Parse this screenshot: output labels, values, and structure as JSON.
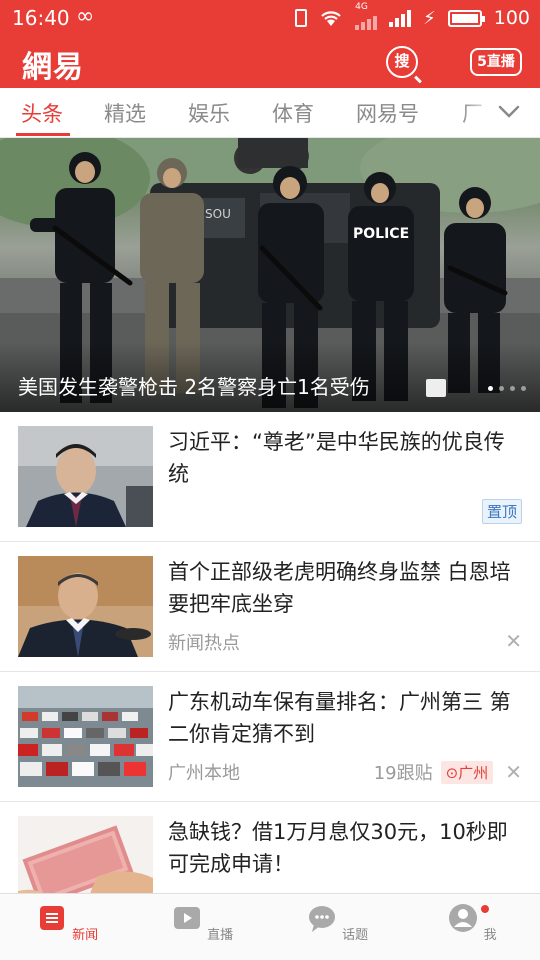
{
  "status_bar": {
    "time": "16:40",
    "infinity": "∞",
    "network": "4G",
    "battery": "100"
  },
  "app_bar": {
    "logo": "網易",
    "search_label": "搜",
    "live_label": "5直播"
  },
  "tabs": [
    {
      "label": "头条",
      "active": true
    },
    {
      "label": "精选",
      "active": false
    },
    {
      "label": "娱乐",
      "active": false
    },
    {
      "label": "体育",
      "active": false
    },
    {
      "label": "网易号",
      "active": false
    },
    {
      "label": "厂",
      "active": false
    }
  ],
  "hero": {
    "caption": "美国发生袭警枪击 2名警察身亡1名受伤",
    "vehicle_text": "SOU",
    "vest_text": "POLICE"
  },
  "news": [
    {
      "title": "习近平：“尊老”是中华民族的优良传统",
      "meta": "",
      "badge": "置顶"
    },
    {
      "title": "首个正部级老虎明确终身监禁 白恩培要把牢底坐穿",
      "meta": "新闻热点"
    },
    {
      "title": "广东机动车保有量排名：广州第三 第二你肯定猜不到",
      "meta": "广州本地",
      "follow": "19跟贴",
      "location": "广州"
    },
    {
      "title": "急缺钱？借1万月息仅30元，10秒即可完成申请！",
      "meta": ""
    }
  ],
  "bottom_nav": [
    {
      "label": "新闻",
      "active": true
    },
    {
      "label": "直播",
      "active": false
    },
    {
      "label": "话题",
      "active": false
    },
    {
      "label": "我",
      "active": false
    }
  ],
  "colors": {
    "brand_red": "#e83c36",
    "tab_gray": "#8a8a8a",
    "meta_gray": "#9a9a9a"
  }
}
